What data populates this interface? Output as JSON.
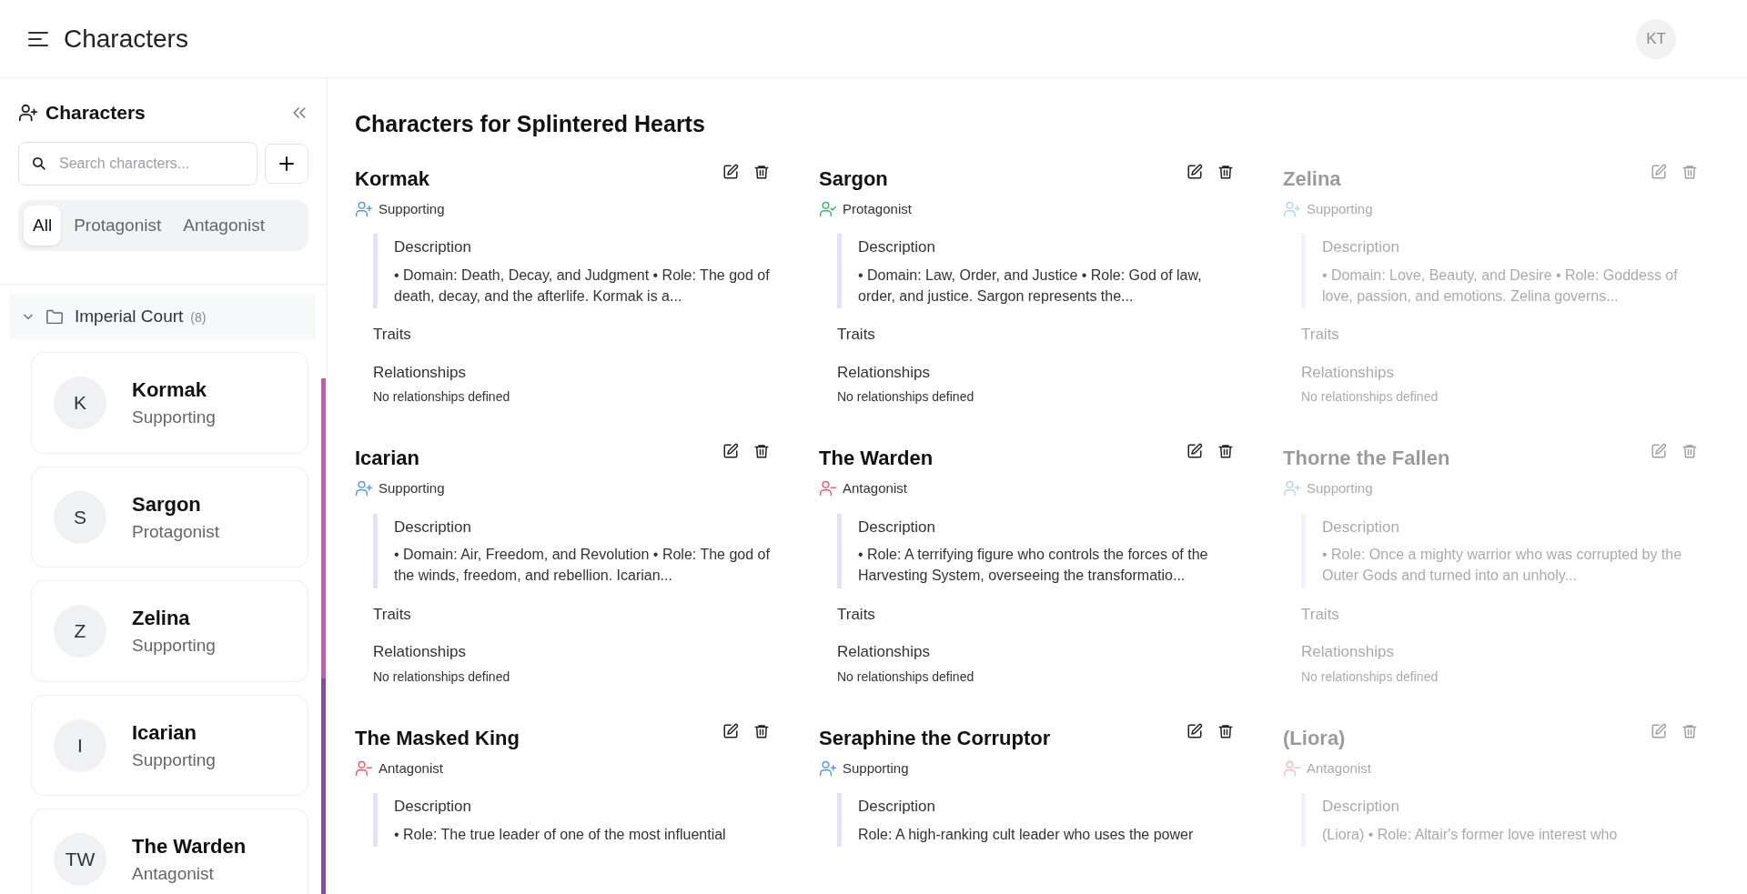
{
  "header": {
    "title": "Characters",
    "user": {
      "initials": "KT"
    }
  },
  "sidebar": {
    "title": "Characters",
    "search": {
      "placeholder": "Search characters..."
    },
    "filters": [
      {
        "label": "All",
        "selected": true
      },
      {
        "label": "Protagonist",
        "selected": false
      },
      {
        "label": "Antagonist",
        "selected": false
      }
    ],
    "groups": [
      {
        "name": "Imperial Court",
        "count": "(8)",
        "expanded": true,
        "items": [
          {
            "initials": "K",
            "name": "Kormak",
            "role": "Supporting"
          },
          {
            "initials": "S",
            "name": "Sargon",
            "role": "Protagonist"
          },
          {
            "initials": "Z",
            "name": "Zelina",
            "role": "Supporting"
          },
          {
            "initials": "I",
            "name": "Icarian",
            "role": "Supporting"
          },
          {
            "initials": "TW",
            "name": "The Warden",
            "role": "Antagonist"
          }
        ]
      }
    ]
  },
  "main": {
    "title": "Characters for Splintered Hearts",
    "cards": [
      {
        "name": "Kormak",
        "kind": "supporting",
        "role": "Supporting",
        "dimmed": false,
        "description_label": "Description",
        "description": "• Domain: Death, Decay, and Judgment • Role: The god of death, decay, and the afterlife. Kormak is a...",
        "traits_label": "Traits",
        "relationships_label": "Relationships",
        "relationships": "No relationships defined"
      },
      {
        "name": "Sargon",
        "kind": "protagonist",
        "role": "Protagonist",
        "dimmed": false,
        "description_label": "Description",
        "description": "• Domain: Law, Order, and Justice • Role: God of law, order, and justice. Sargon represents the...",
        "traits_label": "Traits",
        "relationships_label": "Relationships",
        "relationships": "No relationships defined"
      },
      {
        "name": "Zelina",
        "kind": "supporting",
        "role": "Supporting",
        "dimmed": true,
        "description_label": "Description",
        "description": "• Domain: Love, Beauty, and Desire • Role: Goddess of love, passion, and emotions. Zelina governs...",
        "traits_label": "Traits",
        "relationships_label": "Relationships",
        "relationships": "No relationships defined"
      },
      {
        "name": "Icarian",
        "kind": "supporting",
        "role": "Supporting",
        "dimmed": false,
        "description_label": "Description",
        "description": "• Domain: Air, Freedom, and Revolution • Role: The god of the winds, freedom, and rebellion. Icarian...",
        "traits_label": "Traits",
        "relationships_label": "Relationships",
        "relationships": "No relationships defined"
      },
      {
        "name": "The Warden",
        "kind": "antagonist",
        "role": "Antagonist",
        "dimmed": false,
        "description_label": "Description",
        "description": "• Role: A terrifying figure who controls the forces of the Harvesting System, overseeing the transformatio...",
        "traits_label": "Traits",
        "relationships_label": "Relationships",
        "relationships": "No relationships defined"
      },
      {
        "name": "Thorne the Fallen",
        "kind": "supporting",
        "role": "Supporting",
        "dimmed": true,
        "description_label": "Description",
        "description": "• Role: Once a mighty warrior who was corrupted by the Outer Gods and turned into an unholy...",
        "traits_label": "Traits",
        "relationships_label": "Relationships",
        "relationships": "No relationships defined"
      },
      {
        "name": "The Masked King",
        "kind": "antagonist",
        "role": "Antagonist",
        "dimmed": false,
        "description_label": "Description",
        "description": "• Role: The true leader of one of the most influential"
      },
      {
        "name": "Seraphine the Corruptor",
        "kind": "supporting",
        "role": "Supporting",
        "dimmed": false,
        "description_label": "Description",
        "description": "Role: A high-ranking cult leader who uses the power"
      },
      {
        "name": "(Liora)",
        "kind": "antagonist",
        "role": "Antagonist",
        "dimmed": true,
        "description_label": "Description",
        "description": "(Liora) • Role: Altair's former love interest who"
      }
    ]
  }
}
